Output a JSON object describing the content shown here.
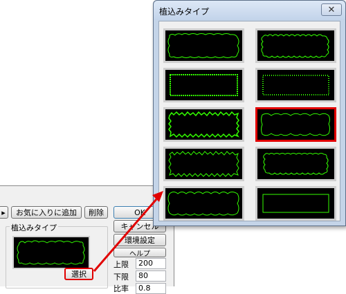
{
  "background_dialog": {
    "toolbar": {
      "favorite_add_label": "お気に入りに追加",
      "delete_label": "削除",
      "ok_label": "OK"
    },
    "cancel_label": "キャンセル",
    "env_settings_label": "環境設定",
    "help_label": "ヘルプ",
    "group_title": "植込みタイプ",
    "select_label": "選択",
    "upper_limit_label": "上限",
    "upper_limit_value": "200",
    "lower_limit_label": "下限",
    "lower_limit_value": "80",
    "ratio_label": "比率",
    "ratio_value": "0.8"
  },
  "popup": {
    "title": "植込みタイプ",
    "close_icon": "close-icon",
    "tiles": [
      {
        "row": 1,
        "col": 1,
        "style": "cloud-outer"
      },
      {
        "row": 1,
        "col": 2,
        "style": "cloud-dense"
      },
      {
        "row": 2,
        "col": 1,
        "style": "fine-tight"
      },
      {
        "row": 2,
        "col": 2,
        "style": "fine-tight-2"
      },
      {
        "row": 3,
        "col": 1,
        "style": "jagged"
      },
      {
        "row": 3,
        "col": 2,
        "style": "wave",
        "selected": true
      },
      {
        "row": 4,
        "col": 1,
        "style": "jagged-2"
      },
      {
        "row": 4,
        "col": 2,
        "style": "cloud-small"
      },
      {
        "row": 5,
        "col": 1,
        "style": "scallop"
      },
      {
        "row": 5,
        "col": 2,
        "style": "plain-rect"
      }
    ]
  },
  "colors": {
    "tile_line": "#33ff00",
    "selection": "#e10000",
    "arrow": "#e10000"
  }
}
